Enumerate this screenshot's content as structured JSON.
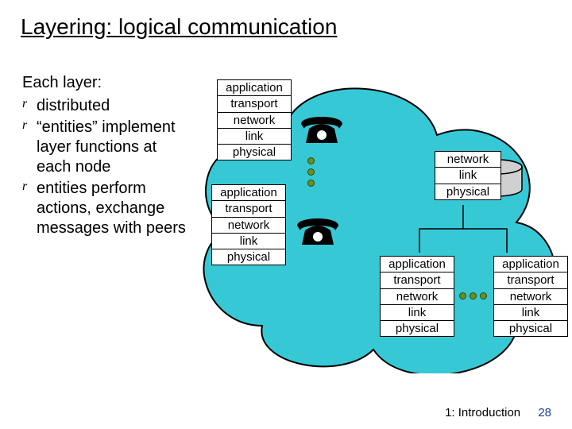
{
  "title": "Layering: logical communication",
  "lead": "Each layer:",
  "bullets": [
    "distributed",
    "“entities” implement layer functions at each node",
    "entities perform actions, exchange messages with peers"
  ],
  "layers5": [
    "application",
    "transport",
    "network",
    "link",
    "physical"
  ],
  "layers3": [
    "network",
    "link",
    "physical"
  ],
  "footer": {
    "chapter": "1: Introduction",
    "page": "28"
  }
}
